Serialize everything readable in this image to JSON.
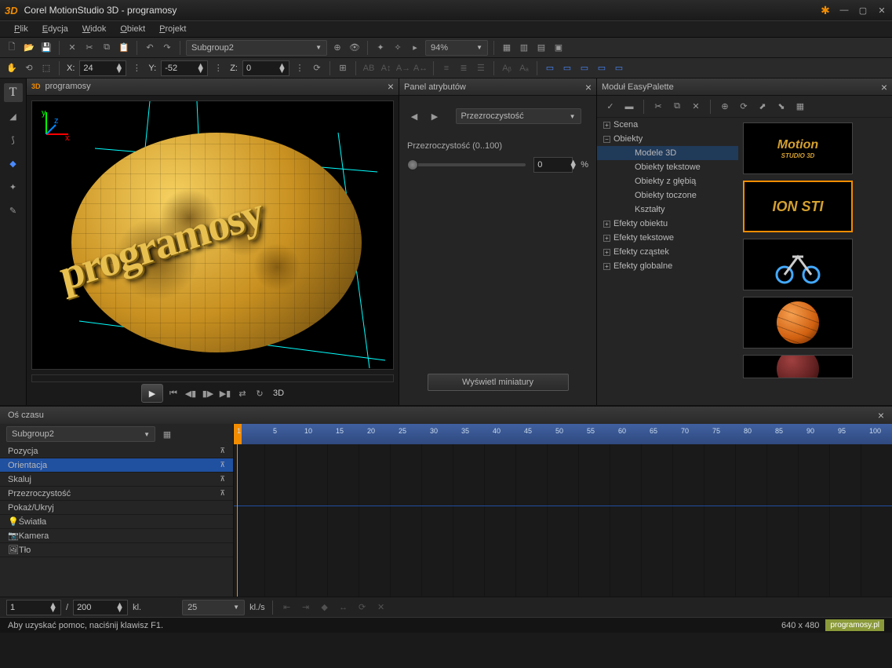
{
  "app": {
    "logo": "3D",
    "title": "Corel MotionStudio 3D - programosy"
  },
  "menu": {
    "items": [
      "Plik",
      "Edycja",
      "Widok",
      "Obiekt",
      "Projekt"
    ]
  },
  "toolbar1": {
    "group_dropdown": "Subgroup2",
    "zoom": "94%"
  },
  "coords": {
    "xl": "X:",
    "x": "24",
    "yl": "Y:",
    "y": "-52",
    "zl": "Z:",
    "z": "0"
  },
  "viewport": {
    "title": "programosy",
    "text3d": "programosy",
    "mode": "3D"
  },
  "attrs": {
    "panel_title": "Panel atrybutów",
    "dropdown": "Przezroczystość",
    "slider_label": "Przezroczystość (0..100)",
    "value": "0",
    "unit": "%",
    "btn": "Wyświetl miniatury"
  },
  "easy": {
    "title": "Moduł EasyPalette",
    "tree": {
      "scena": "Scena",
      "obiekty": "Obiekty",
      "modele": "Modele 3D",
      "tekstowe": "Obiekty tekstowe",
      "glebia": "Obiekty z głębią",
      "toczone": "Obiekty toczone",
      "ksztalty": "Kształty",
      "efobj": "Efekty obiektu",
      "eftxt": "Efekty tekstowe",
      "efcz": "Efekty cząstek",
      "efgl": "Efekty globalne"
    },
    "th1": "Motion",
    "th1b": "STUDIO 3D",
    "th2": "ION   STI"
  },
  "timeline": {
    "title": "Oś czasu",
    "dropdown": "Subgroup2",
    "tracks": [
      "Pozycja",
      "Orientacja",
      "Skaluj",
      "Przezroczystość",
      "Pokaż/Ukryj",
      "Światła",
      "Kamera",
      "Tło"
    ],
    "frame": "1",
    "sep": "/",
    "total": "200",
    "kl": "kl.",
    "fps": "25",
    "fps_unit": "kl./s",
    "ticks": [
      "1",
      "5",
      "10",
      "15",
      "20",
      "25",
      "30",
      "35",
      "40",
      "45",
      "50",
      "55",
      "60",
      "65",
      "70",
      "75",
      "80",
      "85",
      "90",
      "95",
      "100"
    ]
  },
  "status": {
    "help": "Aby uzyskać pomoc, naciśnij klawisz F1.",
    "dims": "640 x 480",
    "brand": "programosy.pl"
  }
}
